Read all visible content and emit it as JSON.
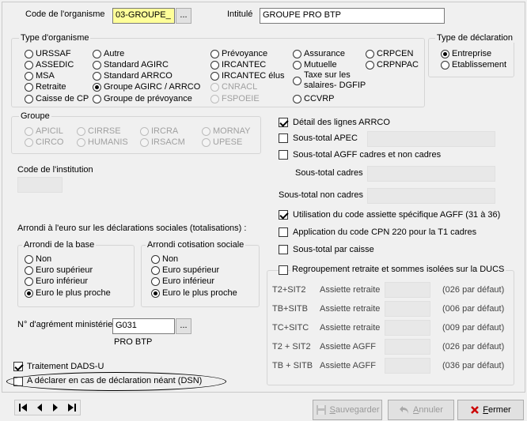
{
  "header": {
    "code_label": "Code de l'organisme",
    "code_value": "03-GROUPE_",
    "lookup_label": "...",
    "intitule_label": "Intitulé",
    "intitule_value": "GROUPE PRO BTP"
  },
  "type_organisme": {
    "title": "Type d'organisme",
    "options": [
      "URSSAF",
      "Autre",
      "Prévoyance",
      "Assurance",
      "CRPCEN",
      "ASSEDIC",
      "Standard AGIRC",
      "IRCANTEC",
      "Mutuelle",
      "CRPNPAC",
      "MSA",
      "Standard ARRCO",
      "IRCANTEC élus",
      "Taxe sur les salaires- DGFIP",
      "Retraite",
      "Groupe AGIRC / ARRCO",
      "CNRACL",
      "Caisse de CP",
      "Groupe de prévoyance",
      "FSPOEIE",
      "CCVRP"
    ],
    "selected": "Groupe AGIRC / ARRCO"
  },
  "type_declaration": {
    "title": "Type de déclaration",
    "options": [
      "Entreprise",
      "Etablissement"
    ],
    "selected": "Entreprise"
  },
  "groupe": {
    "title": "Groupe",
    "options": [
      "APICIL",
      "CIRRSE",
      "IRCRA",
      "MORNAY",
      "CIRCO",
      "HUMANIS",
      "IRSACM",
      "UPESE"
    ]
  },
  "institution": {
    "label": "Code de l'institution"
  },
  "arrondi": {
    "title": "Arrondi à l'euro sur les déclarations sociales (totalisations) :",
    "base": {
      "title": "Arrondi de la base",
      "options": [
        "Non",
        "Euro supérieur",
        "Euro inférieur",
        "Euro le plus proche"
      ],
      "selected": "Euro le plus proche"
    },
    "cotisation": {
      "title": "Arrondi cotisation sociale",
      "options": [
        "Non",
        "Euro supérieur",
        "Euro inférieur",
        "Euro le plus proche"
      ],
      "selected": "Euro le plus proche"
    }
  },
  "agrement": {
    "label": "N° d'agrément ministériel",
    "value": "G031",
    "lookup_label": "...",
    "caption": "PRO BTP"
  },
  "bottom_checks": {
    "dadsu": {
      "label": "Traitement DADS-U",
      "checked": true
    },
    "dsn": {
      "label": "A déclarer en cas de déclaration néant (DSN)",
      "checked": false
    }
  },
  "right_options": {
    "detail_arrco": {
      "label": "Détail des lignes ARRCO",
      "checked": true
    },
    "sous_total_apec": {
      "label": "Sous-total APEC",
      "checked": false
    },
    "sous_total_agff": {
      "label": "Sous-total AGFF cadres et non cadres",
      "checked": false
    },
    "sous_total_cadres": "Sous-total cadres",
    "sous_total_non_cadres": "Sous-total non cadres",
    "code_assiette": {
      "label": "Utilisation du code assiette spécifique AGFF (31 à 36)",
      "checked": true
    },
    "code_cpn": {
      "label": "Application du code CPN 220 pour la T1 cadres",
      "checked": false
    },
    "sous_total_caisse": {
      "label": "Sous-total par caisse",
      "checked": false
    }
  },
  "regroupement": {
    "label": "Regroupement retraite et sommes isolées sur la DUCS",
    "checked": false,
    "rows": [
      {
        "code": "T2+SIT2",
        "type": "Assiette retraite",
        "default": "(026 par défaut)"
      },
      {
        "code": "TB+SITB",
        "type": "Assiette retraite",
        "default": "(006 par défaut)"
      },
      {
        "code": "TC+SITC",
        "type": "Assiette retraite",
        "default": "(009 par défaut)"
      },
      {
        "code": "T2 + SIT2",
        "type": "Assiette AGFF",
        "default": "(026 par défaut)"
      },
      {
        "code": "TB + SITB",
        "type": "Assiette AGFF",
        "default": "(036 par défaut)"
      }
    ]
  },
  "footer": {
    "save_label": "Sauvegarder",
    "cancel_label": "Annuler",
    "close_label": "Fermer"
  },
  "icons": [
    "first-record-icon",
    "previous-record-icon",
    "next-record-icon",
    "last-record-icon",
    "save-icon",
    "undo-icon",
    "close-x-icon"
  ],
  "colors": {
    "code_field_bg": "#ffff99",
    "close_icon": "#cc0000"
  }
}
